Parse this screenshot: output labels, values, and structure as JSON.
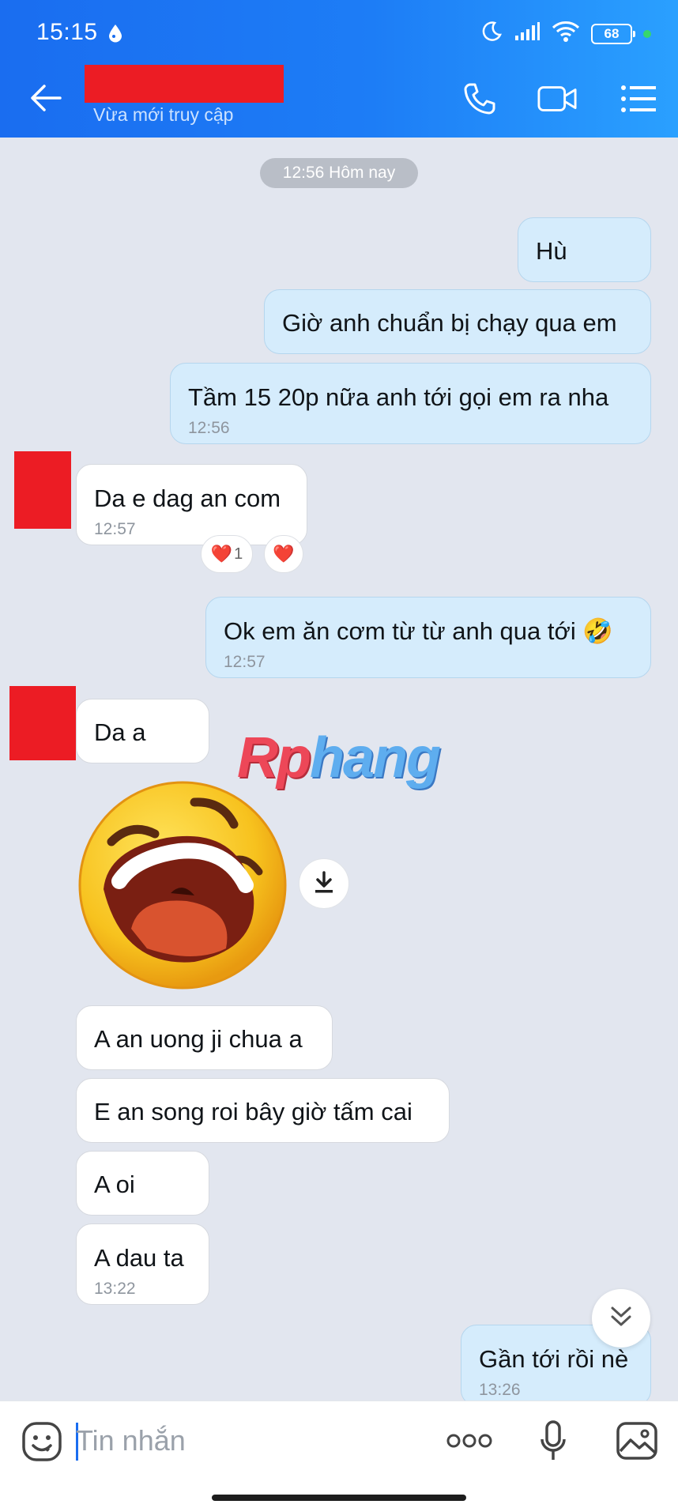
{
  "status_bar": {
    "time": "15:15",
    "battery": "68"
  },
  "header": {
    "subtitle": "Vừa mới truy cập"
  },
  "chat": {
    "date_separator": "12:56 Hôm nay",
    "messages": [
      {
        "side": "me",
        "text": "Hù"
      },
      {
        "side": "me",
        "text": "Giờ anh chuẩn bị chạy qua em"
      },
      {
        "side": "me",
        "text": "Tầm 15 20p nữa anh tới gọi em ra nha",
        "time": "12:56"
      },
      {
        "side": "them",
        "text": "Da e dag an com",
        "time": "12:57"
      },
      {
        "side": "me",
        "text": "Ok em ăn cơm từ từ anh qua tới 🤣",
        "time": "12:57"
      },
      {
        "side": "them",
        "text": "Da a"
      },
      {
        "side": "them",
        "text": "A an uong ji chua a"
      },
      {
        "side": "them",
        "text": "E an song roi bây giờ tấm cai"
      },
      {
        "side": "them",
        "text": "A oi"
      },
      {
        "side": "them",
        "text": "A dau ta",
        "time": "13:22"
      },
      {
        "side": "me",
        "text": "Gần tới rồi nè",
        "time": "13:26"
      }
    ],
    "reaction": {
      "emoji": "❤️",
      "count": "1"
    },
    "reaction_heart": "❤️"
  },
  "watermark": {
    "part1": "Rp",
    "part2": "hang"
  },
  "input": {
    "placeholder": "Tin nhắn"
  },
  "colors": {
    "header_blue": "#1a6df0",
    "my_bubble": "#d5ecfc",
    "their_bubble": "#ffffff",
    "redaction": "#ec1c24"
  }
}
